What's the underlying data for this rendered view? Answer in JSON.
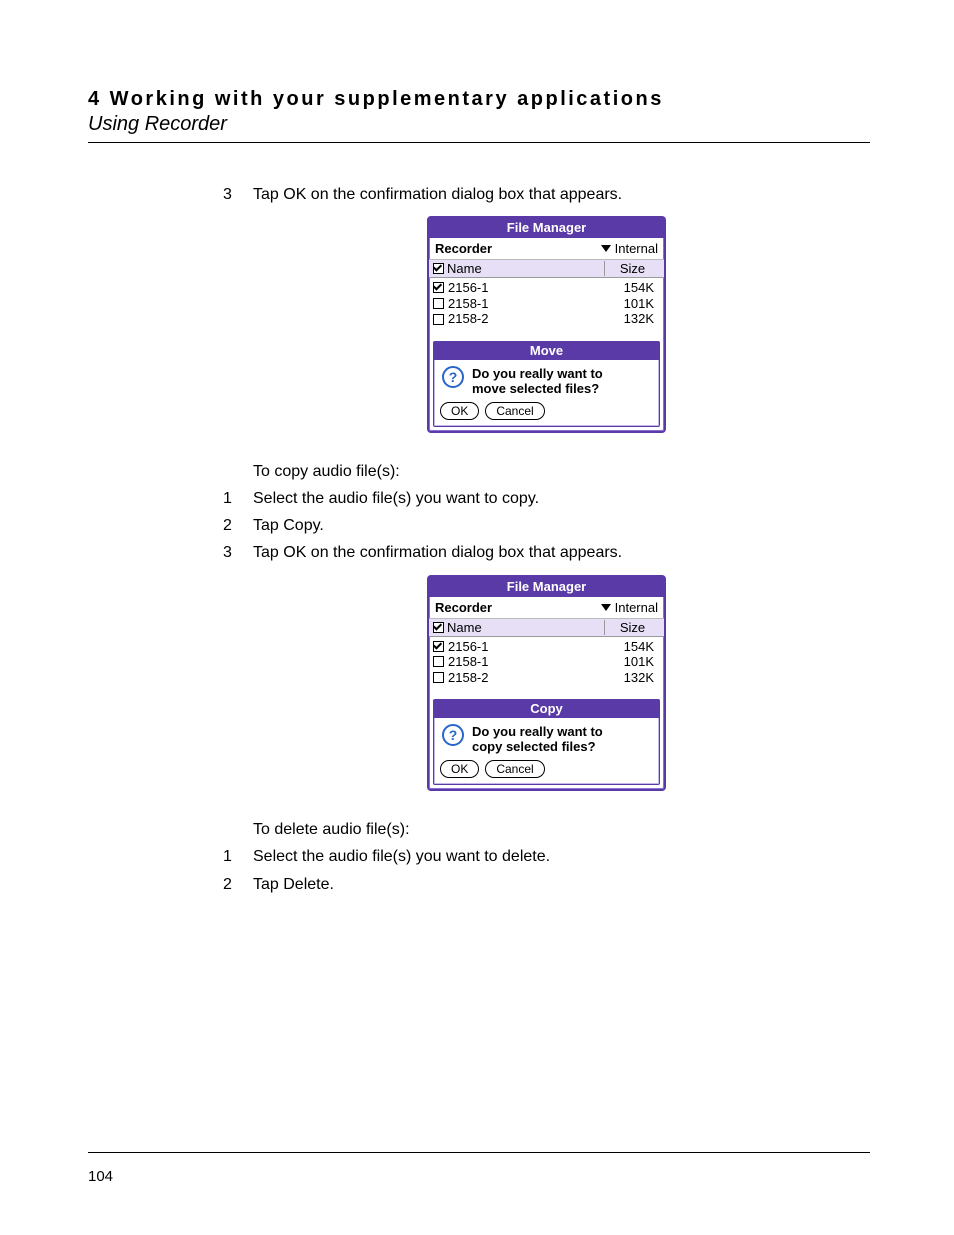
{
  "header": {
    "chapter": "4 Working with your supplementary applications",
    "section": "Using Recorder"
  },
  "page_number": "104",
  "steps_before_move": [
    {
      "num": "3",
      "text": "Tap OK on the confirmation dialog box that appears."
    }
  ],
  "copy_heading": "To copy audio file(s):",
  "steps_copy": [
    {
      "num": "1",
      "text": "Select the audio file(s) you want to copy."
    },
    {
      "num": "2",
      "text": "Tap Copy."
    },
    {
      "num": "3",
      "text": "Tap OK on the confirmation dialog box that appears."
    }
  ],
  "delete_heading": "To delete audio file(s):",
  "steps_delete": [
    {
      "num": "1",
      "text": "Select the audio file(s) you want to delete."
    },
    {
      "num": "2",
      "text": "Tap Delete."
    }
  ],
  "device": {
    "title": "File Manager",
    "app_name": "Recorder",
    "storage_label": "Internal",
    "columns": {
      "name": "Name",
      "size": "Size"
    },
    "files": [
      {
        "name": "2156-1",
        "size": "154K",
        "checked": true
      },
      {
        "name": "2158-1",
        "size": "101K",
        "checked": false
      },
      {
        "name": "2158-2",
        "size": "132K",
        "checked": false
      }
    ],
    "buttons": {
      "ok": "OK",
      "cancel": "Cancel"
    },
    "move_dialog": {
      "title": "Move",
      "line1": "Do you really want to",
      "line2": "move selected files?"
    },
    "copy_dialog": {
      "title": "Copy",
      "line1": "Do you really want to",
      "line2": "copy selected files?"
    }
  }
}
